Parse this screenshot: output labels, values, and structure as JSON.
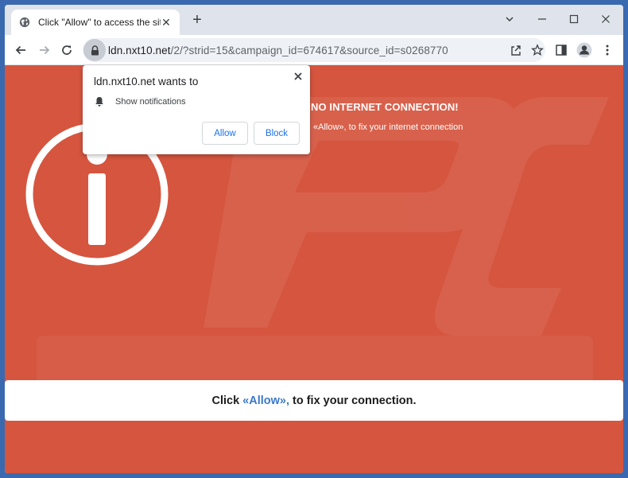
{
  "tab": {
    "title": "Click \"Allow\" to access the site",
    "close_glyph": "✕",
    "new_tab_glyph": "+"
  },
  "omnibox": {
    "host": "ldn.nxt10.net",
    "path": "/2/?strid=15&campaign_id=674617&source_id=s0268770"
  },
  "page": {
    "headline": "NO INTERNET CONNECTION!",
    "subline": "«Allow», to fix your internet connection",
    "bottom_prefix": "Click",
    "bottom_allow": "«Allow»,",
    "bottom_suffix": "to fix your connection."
  },
  "popup": {
    "title": "ldn.nxt10.net wants to",
    "permission": "Show notifications",
    "allow_label": "Allow",
    "block_label": "Block"
  },
  "colors": {
    "page_background": "#d5553f",
    "link_blue": "#3a78c9",
    "button_text": "#1a73e8"
  },
  "icons": {
    "tab": "globe-icon",
    "lock": "lock-icon",
    "permission": "bell-icon",
    "page": "info-icon"
  }
}
